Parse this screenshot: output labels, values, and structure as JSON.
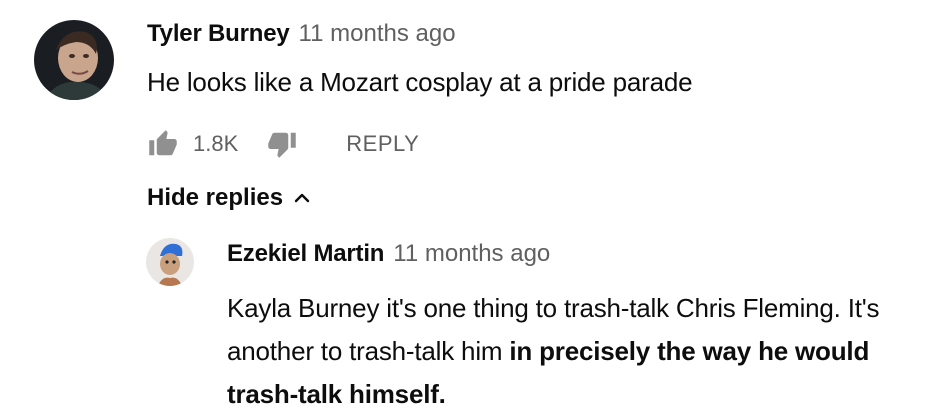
{
  "comment": {
    "author": "Tyler Burney",
    "time": "11 months ago",
    "text": "He looks like a Mozart cosplay at a pride parade",
    "likes": "1.8K",
    "reply_label": "REPLY",
    "icons": {
      "like": "thumbs-up-icon",
      "dislike": "thumbs-down-icon"
    }
  },
  "replies_toggle": {
    "label": "Hide replies",
    "icon": "chevron-up-icon"
  },
  "reply": {
    "author": "Ezekiel Martin",
    "time": "11 months ago",
    "text_plain": "Kayla Burney it's one thing to trash-talk Chris Fleming. It's another to trash-talk him ",
    "text_bold": "in precisely the way he would trash-talk himself."
  }
}
